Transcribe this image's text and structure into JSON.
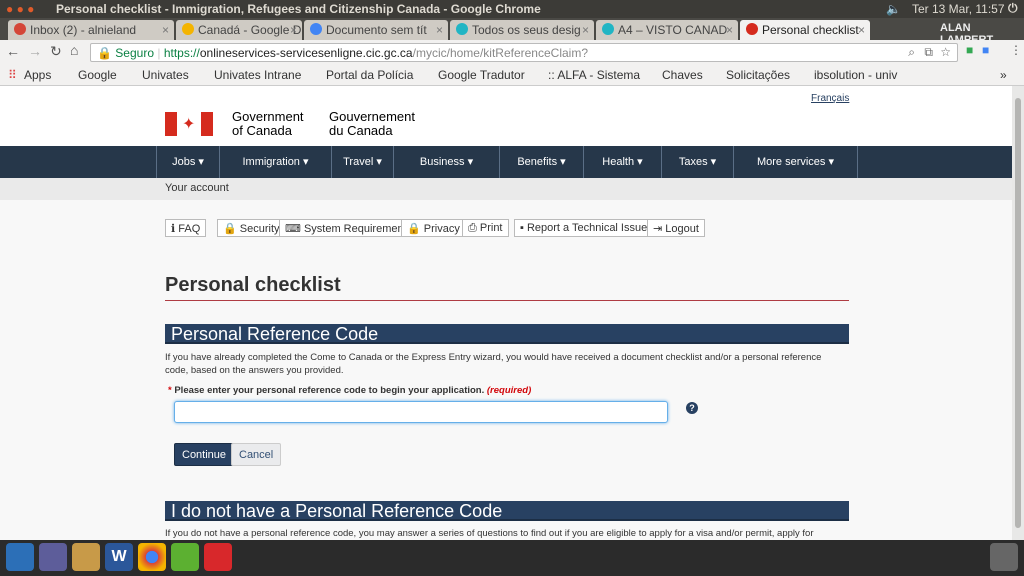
{
  "window": {
    "title": "Personal checklist - Immigration, Refugees and Citizenship Canada - Google Chrome",
    "clock": "Ter 13 Mar, 11:57",
    "user": "ALAN LAMPERT"
  },
  "tabs": [
    {
      "label": "Inbox (2) - alnieland",
      "icon": "gmail-icon",
      "color": "#d44638"
    },
    {
      "label": "Canadá - Google Dr",
      "icon": "drive-icon",
      "color": "#f4b400"
    },
    {
      "label": "Documento sem tít",
      "icon": "docs-icon",
      "color": "#4285f4"
    },
    {
      "label": "Todos os seus desig",
      "icon": "canva-icon",
      "color": "#21b5c4"
    },
    {
      "label": "A4 – VISTO CANAD",
      "icon": "canva-icon",
      "color": "#21b5c4"
    },
    {
      "label": "Personal checklist",
      "icon": "maple-leaf-icon",
      "color": "#d52b1e"
    }
  ],
  "omnibox": {
    "secure": "Seguro",
    "scheme": "https://",
    "host": "onlineservices-servicesenligne.cic.gc.ca",
    "path": "/mycic/home/kitReferenceClaim?"
  },
  "bookmarks": [
    "Apps",
    "Google",
    "Univates",
    "Univates Intrane",
    "Portal da Polícia",
    "Google Tradutor",
    ":: ALFA - Sistema",
    "Chaves",
    "Solicitações",
    "ibsolution - univ"
  ],
  "header": {
    "lang": "Français",
    "gov_en_1": "Government",
    "gov_en_2": "of Canada",
    "gov_fr_1": "Gouvernement",
    "gov_fr_2": "du Canada"
  },
  "nav": [
    "Jobs",
    "Immigration",
    "Travel",
    "Business",
    "Benefits",
    "Health",
    "Taxes",
    "More services"
  ],
  "breadcrumb": "Your account",
  "tools": [
    {
      "label": "FAQ",
      "icon": "info-icon",
      "glyph": "ℹ"
    },
    {
      "label": "Security",
      "icon": "lock-icon",
      "glyph": "🔒"
    },
    {
      "label": "System Requirements",
      "icon": "keyboard-icon",
      "glyph": "⌨"
    },
    {
      "label": "Privacy",
      "icon": "lock-icon",
      "glyph": "🔒"
    },
    {
      "label": "Print",
      "icon": "print-icon",
      "glyph": "⎙"
    },
    {
      "label": "Report a Technical Issue",
      "icon": "comment-icon",
      "glyph": "▪"
    },
    {
      "label": "Logout",
      "icon": "logout-icon",
      "glyph": "⇥"
    }
  ],
  "main": {
    "title": "Personal checklist",
    "section1": {
      "heading": "Personal Reference Code",
      "text": "If you have already completed the Come to Canada or the Express Entry wizard, you would have received a document checklist and/or a personal reference code, based on the answers you provided.",
      "label": "Please enter your personal reference code to begin your application.",
      "required": "(required)",
      "value": "",
      "continue": "Continue",
      "cancel": "Cancel"
    },
    "section2": {
      "heading": "I do not have a Personal Reference Code",
      "text": "If you do not have a personal reference code, you may answer a series of questions to find out if you are eligible to apply for a visa and/or permit, apply for"
    }
  },
  "colors": {
    "nav": "#26374a",
    "band": "#284162",
    "flag": "#d52b1e",
    "required": "#d3080c"
  }
}
